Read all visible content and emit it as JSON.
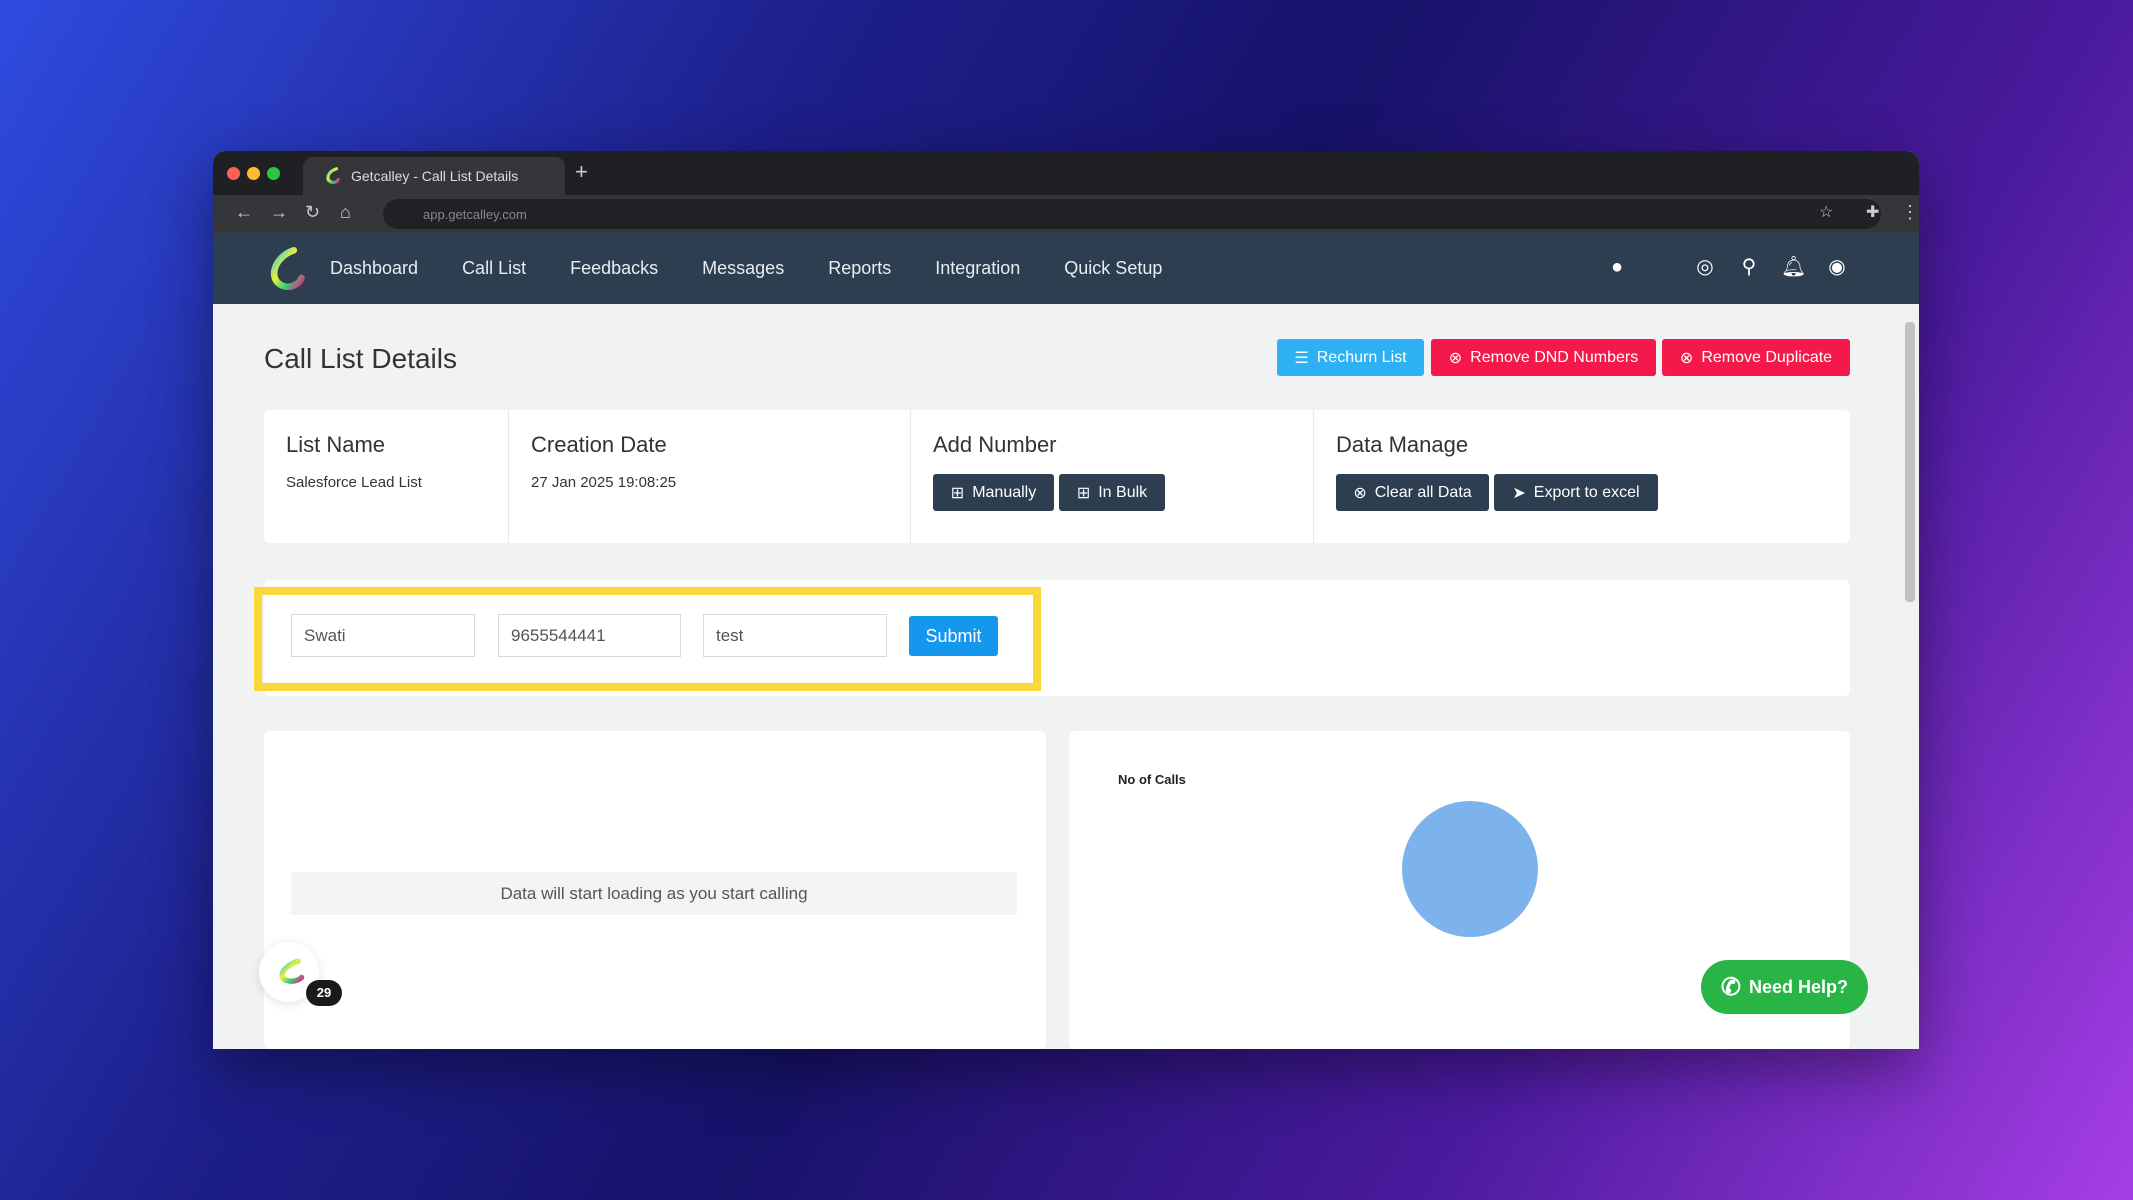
{
  "browser": {
    "tab_title": "Getcalley - Call List Details",
    "url": "app.getcalley.com"
  },
  "nav": {
    "items": [
      "Dashboard",
      "Call List",
      "Feedbacks",
      "Messages",
      "Reports",
      "Integration",
      "Quick Setup"
    ],
    "icons": [
      "android-icon",
      "apple-icon",
      "support-icon",
      "search-icon",
      "bell-icon",
      "user-icon"
    ]
  },
  "page": {
    "title": "Call List Details",
    "actions": {
      "rechurn": "Rechurn List",
      "remove_dnd": "Remove DND Numbers",
      "remove_duplicate": "Remove Duplicate"
    }
  },
  "info": {
    "list_name_label": "List Name",
    "list_name": "Salesforce Lead List",
    "creation_label": "Creation Date",
    "creation_date": "27 Jan 2025 19:08:25",
    "add_label": "Add Number",
    "manually": "Manually",
    "in_bulk": "In Bulk",
    "data_label": "Data Manage",
    "clear": "Clear all Data",
    "export": "Export to excel"
  },
  "form": {
    "name": "Swati",
    "phone": "9655544441",
    "note": "test",
    "submit": "Submit"
  },
  "table": {
    "empty": "Data will start loading as you start calling"
  },
  "chart": {
    "label": "No of Calls"
  },
  "widget": {
    "badge": "29",
    "help": "Need Help?"
  },
  "colors": {
    "nav": "#2c3e50",
    "primary": "#2eb0f5",
    "danger": "#f5184a",
    "highlight": "#fbd83a",
    "whatsapp": "#29b545",
    "pie": "#7db3ec"
  }
}
